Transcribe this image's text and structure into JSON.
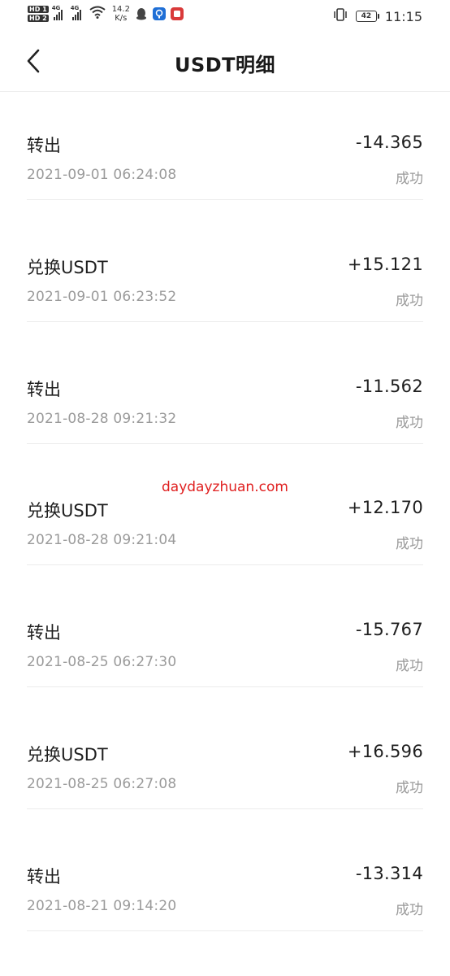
{
  "status_bar": {
    "hd1": "HD 1",
    "hd2": "HD 2",
    "net1": "4G",
    "net2": "4G",
    "speed_value": "14.2",
    "speed_unit": "K/s",
    "battery": "42",
    "time": "11:15",
    "icons": [
      "qq-penguin-icon",
      "blue-app-icon",
      "red-app-icon",
      "vibrate-icon",
      "wifi-icon"
    ]
  },
  "header": {
    "title": "USDT明细",
    "back_icon": "chevron-left-icon"
  },
  "transactions": [
    {
      "title": "转出",
      "amount": "-14.365",
      "time": "2021-09-01 06:24:08",
      "status": "成功"
    },
    {
      "title": "兑换USDT",
      "amount": "+15.121",
      "time": "2021-09-01 06:23:52",
      "status": "成功"
    },
    {
      "title": "转出",
      "amount": "-11.562",
      "time": "2021-08-28 09:21:32",
      "status": "成功"
    },
    {
      "title": "兑换USDT",
      "amount": "+12.170",
      "time": "2021-08-28 09:21:04",
      "status": "成功"
    },
    {
      "title": "转出",
      "amount": "-15.767",
      "time": "2021-08-25 06:27:30",
      "status": "成功"
    },
    {
      "title": "兑换USDT",
      "amount": "+16.596",
      "time": "2021-08-25 06:27:08",
      "status": "成功"
    },
    {
      "title": "转出",
      "amount": "-13.314",
      "time": "2021-08-21 09:14:20",
      "status": "成功"
    }
  ],
  "watermark": "daydayzhuan.com",
  "colors": {
    "watermark": "#e02020",
    "secondary_text": "#9a9a9a",
    "primary_text": "#1f1f1f"
  }
}
